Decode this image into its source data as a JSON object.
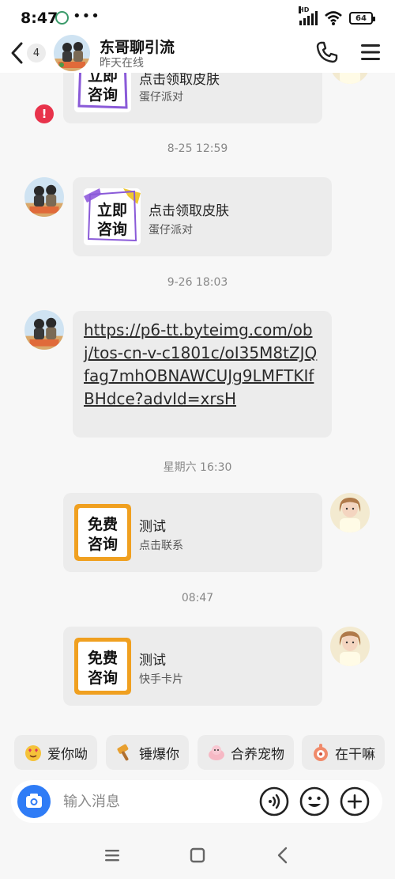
{
  "status_bar": {
    "time": "8:47",
    "dots": "•••",
    "network": "HD",
    "battery": "64"
  },
  "header": {
    "unread_count": "4",
    "contact_name": "东哥聊引流",
    "contact_status": "昨天在线"
  },
  "messages": [
    {
      "type": "card",
      "side": "left-partial",
      "title": "点击领取皮肤",
      "subtitle": "蛋仔派对",
      "image": "立即咨询",
      "error": "!"
    },
    {
      "type": "time",
      "text": "8-25 12:59"
    },
    {
      "type": "card",
      "side": "left",
      "title": "点击领取皮肤",
      "subtitle": "蛋仔派对",
      "image": "立即咨询"
    },
    {
      "type": "time",
      "text": "9-26 18:03"
    },
    {
      "type": "link",
      "side": "left",
      "text": "https://p6-tt.byteimg.com/obj/tos-cn-v-c1801c/oI35M8tZJQfag7mhOBNAWCUJg9LMFTKIfBHdce?advId=xrsH"
    },
    {
      "type": "time",
      "text": "星期六 16:30"
    },
    {
      "type": "card",
      "side": "right",
      "title": "测试",
      "subtitle": "点击联系",
      "image": "免费咨询"
    },
    {
      "type": "time",
      "text": "08:47"
    },
    {
      "type": "card",
      "side": "right",
      "title": "测试",
      "subtitle": "快手卡片",
      "image": "免费咨询"
    }
  ],
  "card_images": {
    "top_line": "立即",
    "bottom_line": "咨询",
    "free_top": "免费",
    "free_bottom": "咨询"
  },
  "quick_replies": [
    {
      "label": "爱你呦",
      "icon": "heart-face-icon"
    },
    {
      "label": "锤爆你",
      "icon": "hammer-icon"
    },
    {
      "label": "合养宠物",
      "icon": "pet-icon"
    },
    {
      "label": "在干嘛",
      "icon": "curious-icon"
    }
  ],
  "input": {
    "placeholder": "输入消息",
    "value": ""
  },
  "colors": {
    "accent_blue": "#2f7cf6",
    "error_red": "#e8334b",
    "bubble_gray": "#ececec",
    "free_card_border": "#f0a020"
  }
}
